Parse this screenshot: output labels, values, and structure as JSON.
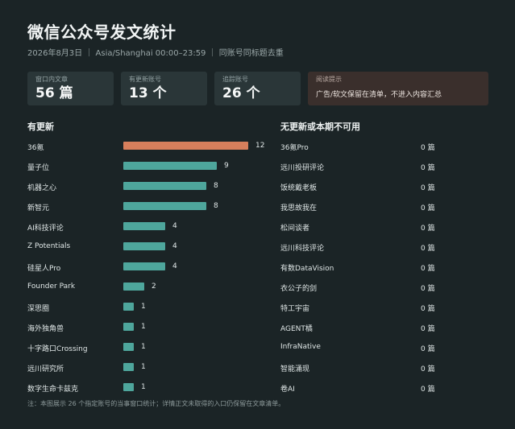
{
  "header": {
    "title": "微信公众号发文统计",
    "subtitle": "2026年8月3日 ｜ Asia/Shanghai 00:00–23:59 ｜ 同账号同标题去重"
  },
  "cards": [
    {
      "label": "窗口内文章",
      "value": "56 篇"
    },
    {
      "label": "有更新账号",
      "value": "13 个"
    },
    {
      "label": "追踪账号",
      "value": "26 个"
    }
  ],
  "warning_card": {
    "label": "阅读提示",
    "note": "广告/软文保留在清单，不进入内容汇总"
  },
  "left_section": {
    "title": "有更新",
    "max": 12,
    "items": [
      {
        "name": "36氪",
        "count": "12",
        "value": 12,
        "highlight": true
      },
      {
        "name": "量子位",
        "count": "9",
        "value": 9
      },
      {
        "name": "机器之心",
        "count": "8",
        "value": 8
      },
      {
        "name": "新智元",
        "count": "8",
        "value": 8
      },
      {
        "name": "AI科技评论",
        "count": "4",
        "value": 4
      },
      {
        "name": "Z Potentials",
        "count": "4",
        "value": 4
      },
      {
        "name": "硅星人Pro",
        "count": "4",
        "value": 4
      },
      {
        "name": "Founder Park",
        "count": "2",
        "value": 2
      },
      {
        "name": "深思圈",
        "count": "1",
        "value": 1
      },
      {
        "name": "海外独角兽",
        "count": "1",
        "value": 1
      },
      {
        "name": "十字路口Crossing",
        "count": "1",
        "value": 1
      },
      {
        "name": "远川研究所",
        "count": "1",
        "value": 1
      },
      {
        "name": "数字生命卡兹克",
        "count": "1",
        "value": 1
      }
    ]
  },
  "right_section": {
    "title": "无更新或本期不可用",
    "items": [
      {
        "name": "36氪Pro",
        "count": "0 篇"
      },
      {
        "name": "远川投研评论",
        "count": "0 篇"
      },
      {
        "name": "饭统戴老板",
        "count": "0 篇"
      },
      {
        "name": "我思故我在",
        "count": "0 篇"
      },
      {
        "name": "松间谈者",
        "count": "0 篇"
      },
      {
        "name": "远川科技评论",
        "count": "0 篇"
      },
      {
        "name": "有数DataVision",
        "count": "0 篇"
      },
      {
        "name": "衣公子的剑",
        "count": "0 篇"
      },
      {
        "name": "特工宇宙",
        "count": "0 篇"
      },
      {
        "name": "AGENT橘",
        "count": "0 篇"
      },
      {
        "name": "InfraNative",
        "count": "0 篇"
      },
      {
        "name": "智能涌现",
        "count": "0 篇"
      },
      {
        "name": "卷AI",
        "count": "0 篇"
      }
    ]
  },
  "footnote": "注：本图展示 26 个指定账号的当事窗口统计；详情正文未取得的入口仍保留在文章清单。",
  "colors": {
    "highlight_bar": "#d77f5c",
    "bar": "#4ea69c",
    "warning_bg": "#3a2f2c"
  }
}
